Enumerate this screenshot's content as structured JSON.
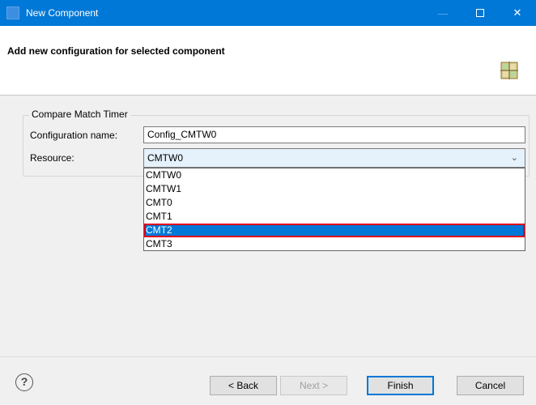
{
  "window": {
    "title": "New Component",
    "minimize_label": "—",
    "close_label": "✕"
  },
  "banner": {
    "heading": "Add new configuration for selected component",
    "icon": "component-grid-icon"
  },
  "group": {
    "label": "Compare Match Timer",
    "config_name_label": "Configuration name:",
    "config_name_value": "Config_CMTW0",
    "resource_label": "Resource:",
    "resource_selected": "CMTW0"
  },
  "dropdown": {
    "options": [
      "CMTW0",
      "CMTW1",
      "CMT0",
      "CMT1",
      "CMT2",
      "CMT3"
    ],
    "highlighted": "CMT2"
  },
  "buttons": {
    "help": "?",
    "back": "< Back",
    "next": "Next >",
    "finish": "Finish",
    "cancel": "Cancel"
  },
  "colors": {
    "titlebar": "#0078d7",
    "selection": "#0078d7",
    "highlight_outline": "#e3001b"
  }
}
